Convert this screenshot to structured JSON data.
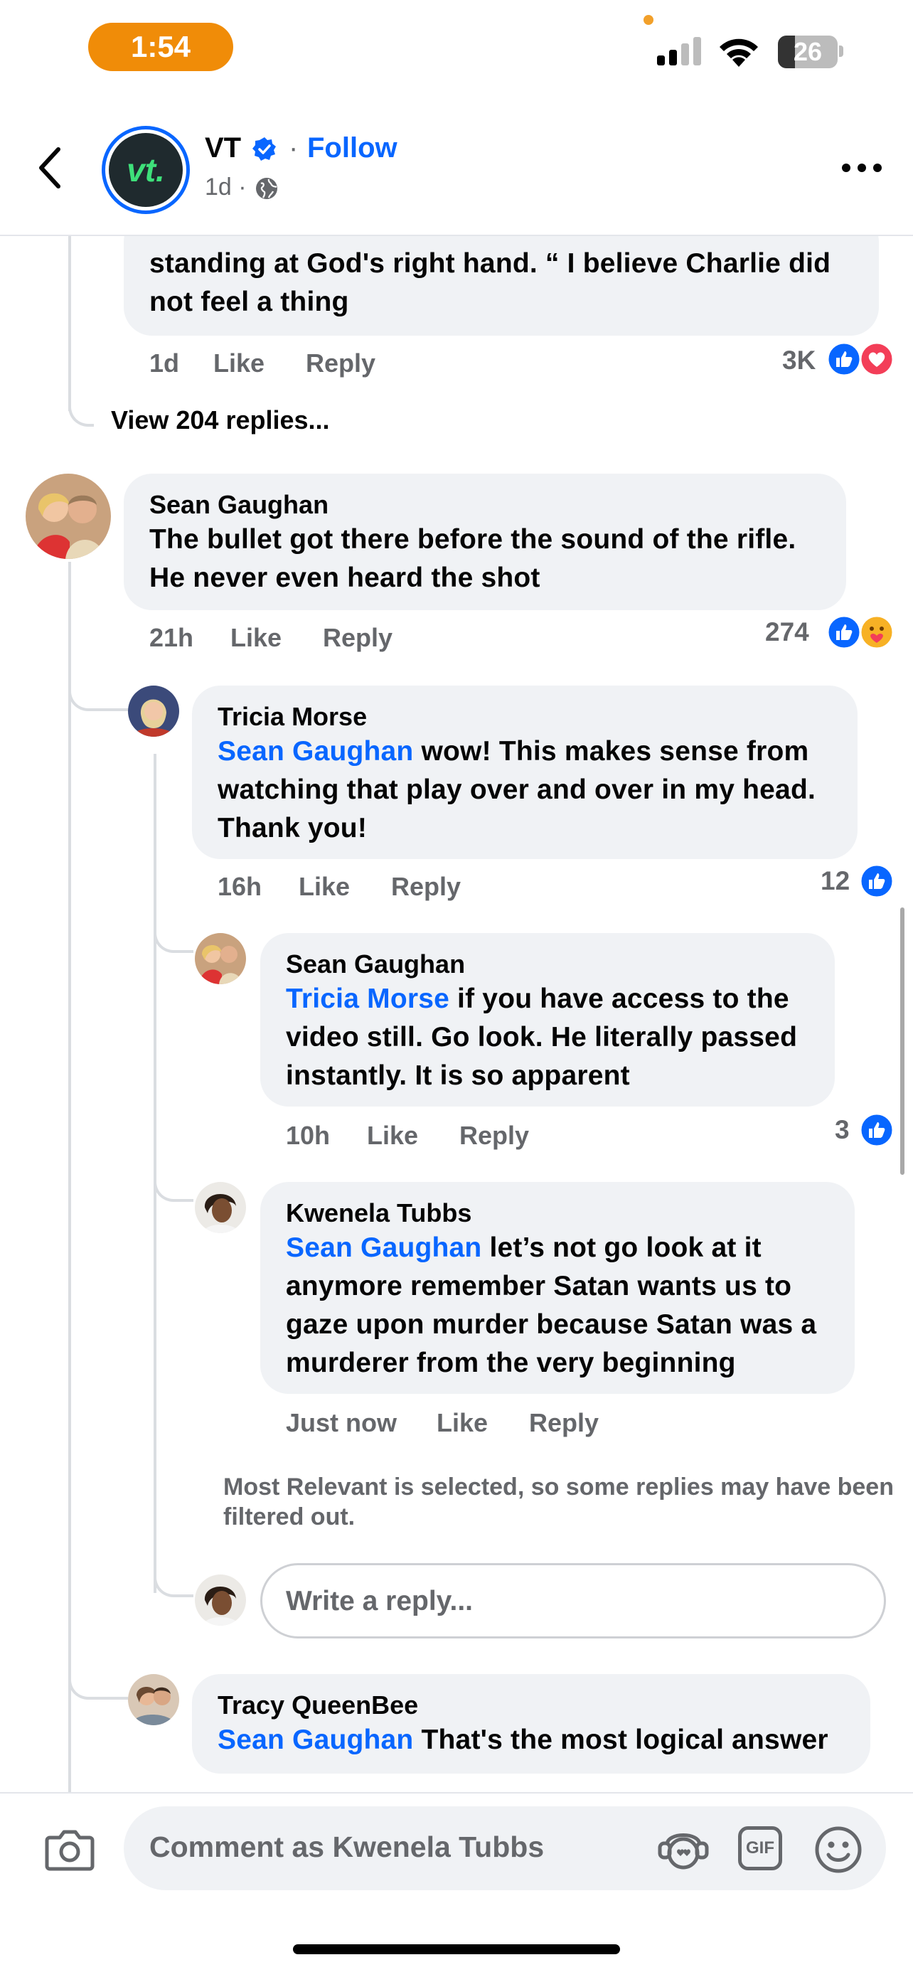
{
  "status_bar": {
    "time": "1:54",
    "battery": "26"
  },
  "post_header": {
    "page_name": "VT",
    "avatar_text": "vt.",
    "separator": "·",
    "follow_label": "Follow",
    "post_time": "1d ·"
  },
  "top_comment": {
    "text": "standing at God's right hand. “ I believe Charlie did not feel a thing",
    "time": "1d",
    "like_label": "Like",
    "reply_label": "Reply",
    "reaction_count": "3K",
    "view_replies": "View 204 replies..."
  },
  "comments": [
    {
      "name": "Sean Gaughan",
      "text": "The bullet got there before the sound of the rifle. He never even heard the shot",
      "time": "21h",
      "like_label": "Like",
      "reply_label": "Reply",
      "reaction_count": "274"
    },
    {
      "name": "Tricia Morse",
      "mention": "Sean Gaughan",
      "text": " wow! This makes sense from watching that play over and over in my head. Thank you!",
      "time": "16h",
      "like_label": "Like",
      "reply_label": "Reply",
      "reaction_count": "12"
    },
    {
      "name": "Sean Gaughan",
      "mention": "Tricia Morse",
      "text": " if you have access to the video still. Go look. He literally passed instantly.  It is so apparent",
      "time": "10h",
      "like_label": "Like",
      "reply_label": "Reply",
      "reaction_count": "3"
    },
    {
      "name": "Kwenela Tubbs",
      "mention": "Sean Gaughan",
      "text": " let’s not go look at it anymore remember Satan wants us to gaze upon murder because Satan was a murderer from the very beginning",
      "time": "Just now",
      "like_label": "Like",
      "reply_label": "Reply"
    },
    {
      "name": "Tracy QueenBee",
      "mention": "Sean Gaughan",
      "text": " That's the most logical answer"
    }
  ],
  "filter_notice": "Most Relevant is selected, so some replies may have been filtered out.",
  "reply_placeholder": "Write a reply...",
  "composer": {
    "placeholder": "Comment as Kwenela Tubbs",
    "gif_label": "GIF"
  },
  "colors": {
    "accent": "#0866ff",
    "bubble": "#f0f2f5",
    "secondary_text": "#65676b",
    "love": "#f33e58",
    "status_pill": "#f08c08"
  },
  "icons": [
    "back-arrow-icon",
    "verified-badge-icon",
    "globe-icon",
    "more-options-icon",
    "like-reaction-icon",
    "love-reaction-icon",
    "care-reaction-icon",
    "camera-icon",
    "avatar-sticker-icon",
    "gif-icon",
    "emoji-icon",
    "signal-icon",
    "wifi-icon"
  ]
}
